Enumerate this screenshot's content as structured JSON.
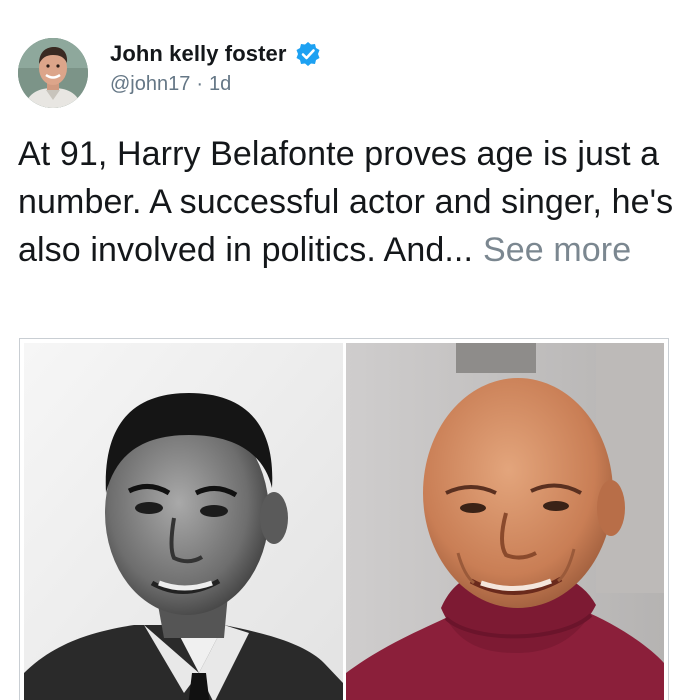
{
  "author": {
    "display_name": "John kelly foster",
    "handle": "@john17",
    "separator": "·",
    "timestamp": "1d",
    "verified": true,
    "avatar_icon": "person-avatar"
  },
  "tweet": {
    "text": "At 91, Harry Belafonte proves age is just a number. A successful actor and singer, he's also involved in politics. And...",
    "see_more_label": "See more"
  },
  "media": {
    "images": [
      {
        "description_icon": "black-and-white-portrait-young-man"
      },
      {
        "description_icon": "color-portrait-elderly-man-red-sweater"
      }
    ]
  },
  "colors": {
    "text": "#14171a",
    "secondary": "#657786",
    "see_more": "#7b8790",
    "verified_blue": "#1da1f2",
    "sweater_red": "#8b1f3a"
  }
}
